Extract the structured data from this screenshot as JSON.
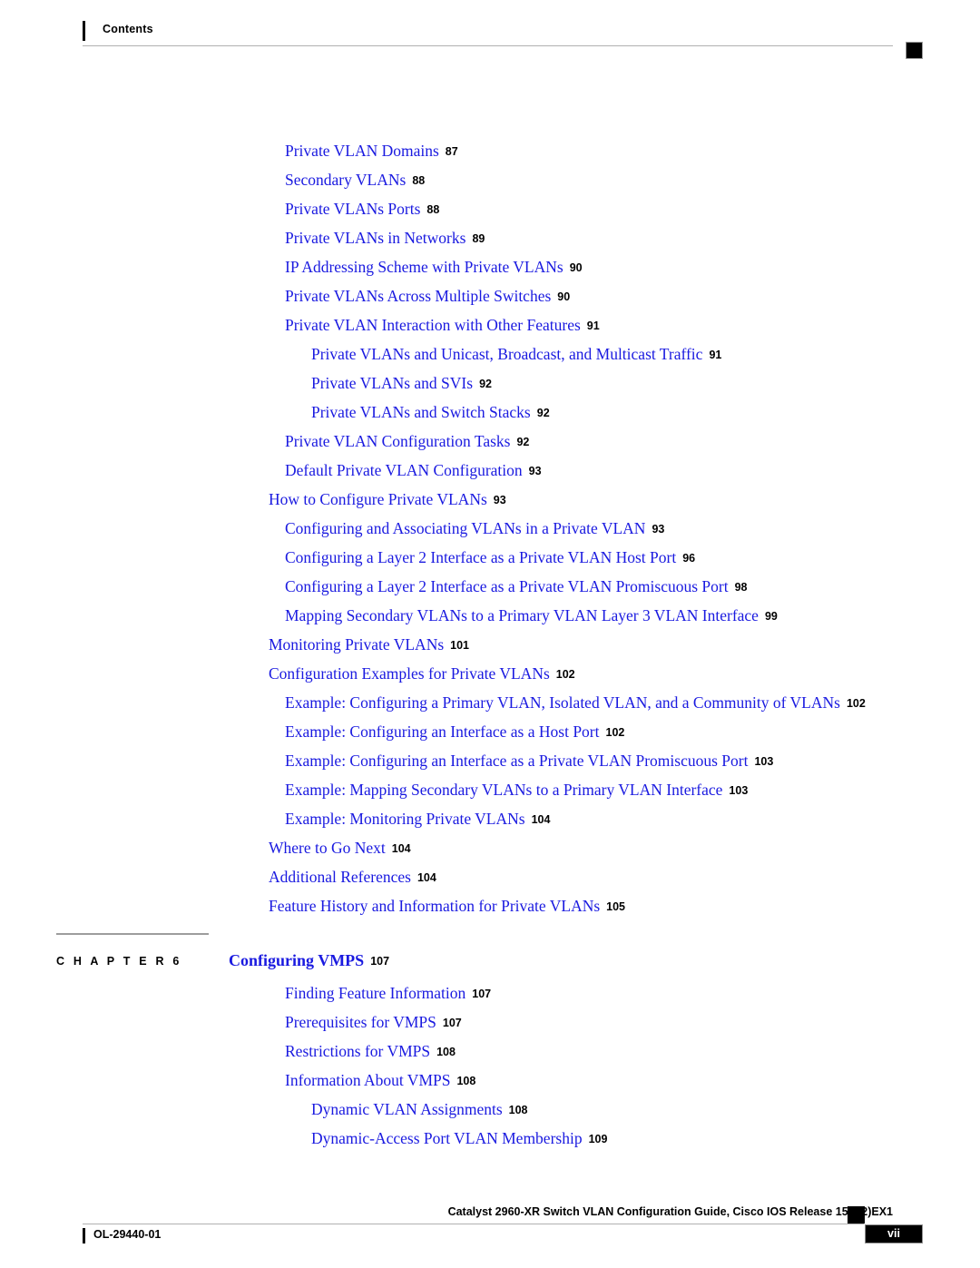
{
  "header": {
    "title": "Contents",
    "marker_icon": "black-square-marker"
  },
  "toc": {
    "entries": [
      {
        "level": 2,
        "title": "Private VLAN Domains",
        "page": "87"
      },
      {
        "level": 2,
        "title": "Secondary VLANs",
        "page": "88"
      },
      {
        "level": 2,
        "title": "Private VLANs Ports",
        "page": "88"
      },
      {
        "level": 2,
        "title": "Private VLANs in Networks",
        "page": "89"
      },
      {
        "level": 2,
        "title": "IP Addressing Scheme with Private VLANs",
        "page": "90"
      },
      {
        "level": 2,
        "title": "Private VLANs Across Multiple Switches",
        "page": "90"
      },
      {
        "level": 2,
        "title": "Private VLAN Interaction with Other Features",
        "page": "91"
      },
      {
        "level": 3,
        "title": "Private VLANs and Unicast, Broadcast, and Multicast Traffic",
        "page": "91"
      },
      {
        "level": 3,
        "title": "Private VLANs and SVIs",
        "page": "92"
      },
      {
        "level": 3,
        "title": "Private VLANs and Switch Stacks",
        "page": "92"
      },
      {
        "level": 2,
        "title": "Private VLAN Configuration Tasks",
        "page": "92"
      },
      {
        "level": 2,
        "title": "Default Private VLAN Configuration",
        "page": "93"
      },
      {
        "level": 1,
        "title": "How to Configure Private VLANs",
        "page": "93"
      },
      {
        "level": 2,
        "title": "Configuring and Associating VLANs in a Private VLAN",
        "page": "93"
      },
      {
        "level": 2,
        "title": "Configuring a Layer 2 Interface as a Private VLAN Host Port",
        "page": "96"
      },
      {
        "level": 2,
        "title": "Configuring a Layer 2 Interface as a Private VLAN Promiscuous Port",
        "page": "98"
      },
      {
        "level": 2,
        "title": "Mapping Secondary VLANs to a Primary VLAN Layer 3 VLAN Interface",
        "page": "99"
      },
      {
        "level": 1,
        "title": "Monitoring Private VLANs",
        "page": "101"
      },
      {
        "level": 1,
        "title": "Configuration Examples for Private VLANs",
        "page": "102"
      },
      {
        "level": 2,
        "title": "Example: Configuring a Primary VLAN, Isolated VLAN, and a Community of VLANs",
        "page": "102"
      },
      {
        "level": 2,
        "title": "Example: Configuring an Interface as a Host Port",
        "page": "102"
      },
      {
        "level": 2,
        "title": "Example: Configuring an Interface as a Private VLAN Promiscuous Port",
        "page": "103"
      },
      {
        "level": 2,
        "title": "Example: Mapping Secondary VLANs to a Primary VLAN Interface",
        "page": "103"
      },
      {
        "level": 2,
        "title": "Example: Monitoring Private VLANs",
        "page": "104"
      },
      {
        "level": 1,
        "title": "Where to Go Next",
        "page": "104"
      },
      {
        "level": 1,
        "title": "Additional References",
        "page": "104"
      },
      {
        "level": 1,
        "title": "Feature History and Information for Private VLANs",
        "page": "105"
      }
    ]
  },
  "chapter": {
    "label": "C H A P T E R  6",
    "title": "Configuring VMPS",
    "page": "107"
  },
  "toc_tail": {
    "entries": [
      {
        "level": 2,
        "title": "Finding Feature Information",
        "page": "107"
      },
      {
        "level": 2,
        "title": "Prerequisites for VMPS",
        "page": "107"
      },
      {
        "level": 2,
        "title": "Restrictions for VMPS",
        "page": "108"
      },
      {
        "level": 2,
        "title": "Information About VMPS",
        "page": "108"
      },
      {
        "level": 3,
        "title": "Dynamic VLAN Assignments",
        "page": "108"
      },
      {
        "level": 3,
        "title": "Dynamic-Access Port VLAN Membership",
        "page": "109"
      }
    ]
  },
  "footer": {
    "doc_title": "Catalyst 2960-XR Switch VLAN Configuration Guide, Cisco IOS Release 15.0(2)EX1",
    "doc_id": "OL-29440-01",
    "page_number": "vii",
    "marker_icon": "black-square-marker"
  },
  "colors": {
    "link_blue": "#1a1ae0",
    "text_black": "#000000",
    "rule_gray": "#b0b0b0",
    "page_background": "#ffffff"
  }
}
